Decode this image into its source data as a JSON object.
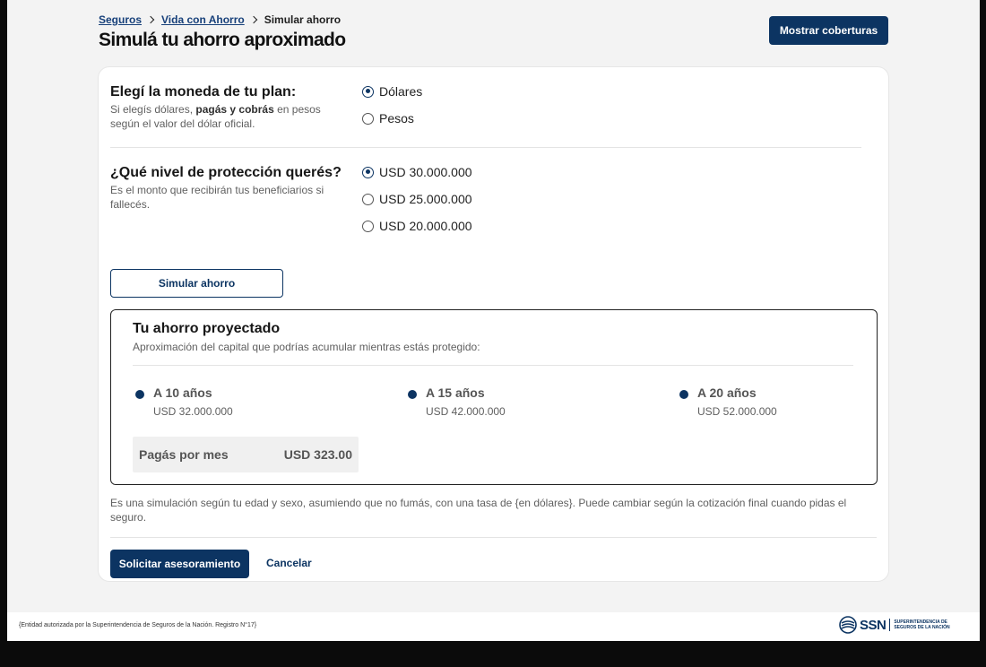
{
  "breadcrumb": {
    "items": [
      {
        "label": "Seguros"
      },
      {
        "label": "Vida con Ahorro"
      }
    ],
    "current": "Simular ahorro"
  },
  "header": {
    "title": "Simulá tu ahorro aproximado",
    "coverage_button": "Mostrar coberturas"
  },
  "currency": {
    "title": "Elegí la moneda de tu plan:",
    "desc_pre": "Si elegís dólares, ",
    "desc_bold": "pagás y cobrás",
    "desc_post": " en pesos según el valor del dólar oficial.",
    "options": [
      {
        "label": "Dólares",
        "selected": true
      },
      {
        "label": "Pesos",
        "selected": false
      }
    ]
  },
  "protection": {
    "title": "¿Qué nivel de protección querés?",
    "desc": "Es el monto que recibirán tus beneficiarios si fallecés.",
    "options": [
      {
        "label": "USD 30.000.000",
        "selected": true
      },
      {
        "label": "USD 25.000.000",
        "selected": false
      },
      {
        "label": "USD 20.000.000",
        "selected": false
      }
    ]
  },
  "simulate_button": "Simular ahorro",
  "projection": {
    "title": "Tu ahorro proyectado",
    "subtitle": "Aproximación del capital que podrías acumular mientras estás protegido:",
    "terms": [
      {
        "label": "A 10 años",
        "amount": "USD 32.000.000"
      },
      {
        "label": "A 15 años",
        "amount": "USD 42.000.000"
      },
      {
        "label": "A 20 años",
        "amount": "USD 52.000.000"
      }
    ],
    "monthly_label": "Pagás por mes",
    "monthly_value": "USD 323.00"
  },
  "disclaimer": "Es una simulación según tu edad y sexo, asumiendo que no fumás, con una tasa de {en dólares}. Puede cambiar según la cotización final cuando pidas el seguro.",
  "actions": {
    "request": "Solicitar asesoramiento",
    "cancel": "Cancelar"
  },
  "footer": {
    "legal": "{Entidad autorizada por la Superintendencia de Seguros de la Nación. Registro N°17}",
    "logo_text": "SSN",
    "logo_sub": "SUPERINTENDENCIA DE SEGUROS DE LA NACIÓN"
  },
  "colors": {
    "brand": "#0c3462",
    "background": "#f3f3f3"
  }
}
